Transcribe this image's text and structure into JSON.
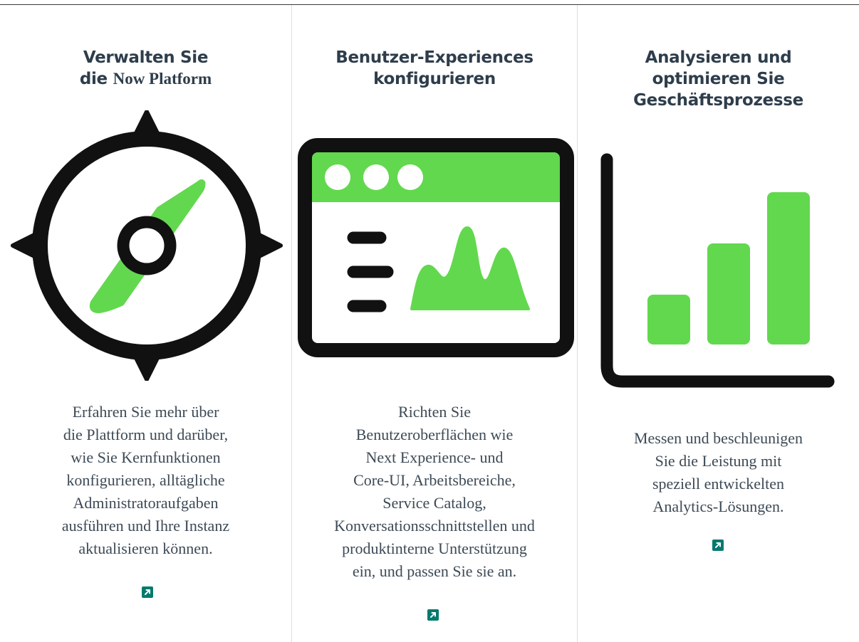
{
  "colors": {
    "accent_green": "#62d84e",
    "icon_black": "#111111",
    "heading": "#2e3d4b",
    "body_text": "#3d4a56",
    "link_button": "#057a6f"
  },
  "cards": [
    {
      "icon": "compass-icon",
      "title_lines": [
        "Verwalten Sie"
      ],
      "title_last": {
        "sans": "die",
        "serif": "Now Platform"
      },
      "description_lines": [
        "Erfahren Sie mehr über",
        "die Plattform und darüber,",
        "wie Sie Kernfunktionen",
        "konfigurieren, alltägliche",
        "Administratoraufgaben",
        "ausführen und Ihre Instanz",
        "aktualisieren können."
      ],
      "link_icon": "external-link-icon"
    },
    {
      "icon": "browser-window-icon",
      "title_lines": [
        "Benutzer-Experiences",
        "konfigurieren"
      ],
      "description_lines": [
        "Richten Sie",
        "Benutzeroberflächen wie",
        "Next Experience- und",
        "Core-UI, Arbeitsbereiche,",
        "Service Catalog,",
        "Konversationsschnittstellen und",
        "produktinterne Unterstützung",
        "ein, und passen Sie sie an."
      ],
      "link_icon": "external-link-icon"
    },
    {
      "icon": "bar-chart-icon",
      "title_lines": [
        "Analysieren und",
        "optimieren Sie",
        "Geschäftsprozesse"
      ],
      "description_lines": [
        "Messen und beschleunigen",
        "Sie die Leistung mit",
        "speziell entwickelten",
        "Analytics-Lösungen."
      ],
      "link_icon": "external-link-icon"
    }
  ]
}
